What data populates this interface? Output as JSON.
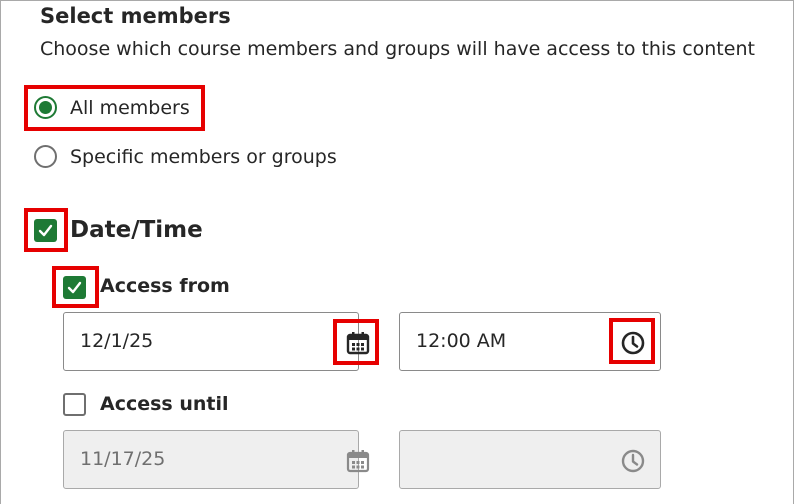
{
  "section": {
    "title": "Select members",
    "subtitle": "Choose which course members and groups will have access to this content"
  },
  "members": {
    "options": [
      {
        "label": "All members",
        "selected": true
      },
      {
        "label": "Specific members or groups",
        "selected": false
      }
    ]
  },
  "datetime": {
    "label": "Date/Time",
    "checked": true,
    "access_from": {
      "label": "Access from",
      "checked": true,
      "date": "12/1/25",
      "time": "12:00 AM",
      "date_icon": "calendar-icon",
      "time_icon": "clock-icon"
    },
    "access_until": {
      "label": "Access until",
      "checked": false,
      "date": "11/17/25",
      "time": "",
      "date_icon": "calendar-icon",
      "time_icon": "clock-icon"
    }
  },
  "colors": {
    "accent_green": "#1e7a35",
    "highlight_red": "#e60000",
    "text": "#262626",
    "disabled_bg": "#efefef"
  }
}
